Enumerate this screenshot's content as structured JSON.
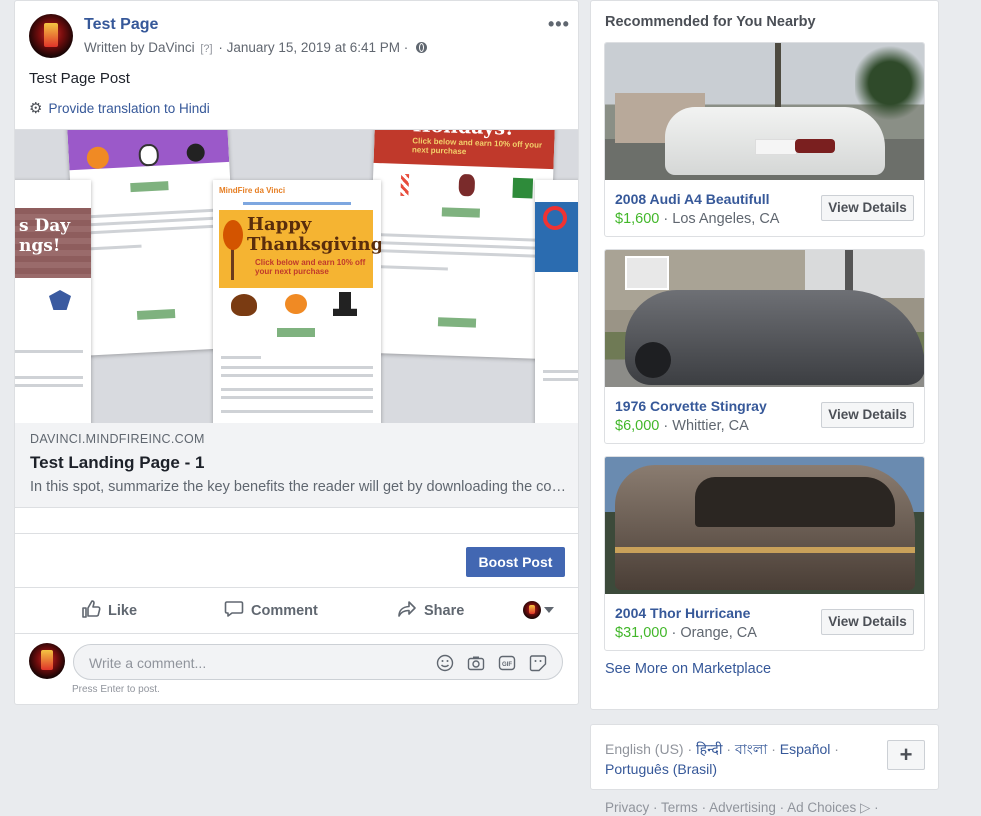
{
  "post": {
    "page_name": "Test Page",
    "written_by": "Written by",
    "author": "DaVinci",
    "author_hint": "[?]",
    "timestamp": "January 15, 2019 at 6:41 PM",
    "separator": "·",
    "more_menu": "•••",
    "text": "Test Page Post",
    "translate_link": "Provide translation to Hindi",
    "preview": {
      "domain": "DAVINCI.MINDFIREINC.COM",
      "title": "Test Landing Page - 1",
      "description": "In this spot, summarize the key benefits the reader will get by downloading the content.",
      "image_text": {
        "thanksgiving_line1": "Happy",
        "thanksgiving_line2": "Thanksgiving!",
        "promo": "Click below and earn 10% off your next purchase",
        "holidays": "Holidays!",
        "brand": "MindFire da Vinci",
        "days": "s Day",
        "ngs": "ngs!"
      }
    },
    "boost_label": "Boost Post",
    "actions": {
      "like": "Like",
      "comment": "Comment",
      "share": "Share"
    },
    "comment_placeholder": "Write a comment...",
    "press_enter": "Press Enter to post."
  },
  "marketplace": {
    "heading": "Recommended for You Nearby",
    "listings": [
      {
        "name": "2008 Audi A4 Beautifull",
        "price": "$1,600",
        "location": "Los Angeles, CA",
        "button": "View Details"
      },
      {
        "name": "1976 Corvette Stingray",
        "price": "$6,000",
        "location": "Whittier, CA",
        "button": "View Details"
      },
      {
        "name": "2004 Thor Hurricane",
        "price": "$31,000",
        "location": "Orange, CA",
        "button": "View Details"
      }
    ],
    "price_sep": "·",
    "see_more": "See More on Marketplace"
  },
  "languages": {
    "current": "English (US)",
    "options": [
      "हिन्दी",
      "বাংলা",
      "Español",
      "Português (Brasil)"
    ],
    "sep": "·",
    "add_label": "+"
  },
  "footer": {
    "links": [
      "Privacy",
      "Terms",
      "Advertising",
      "Ad Choices"
    ],
    "sep": "·"
  },
  "colors": {
    "link": "#365899",
    "boost": "#4267b2",
    "price_green": "#42b72a",
    "background": "#e9ebee"
  }
}
